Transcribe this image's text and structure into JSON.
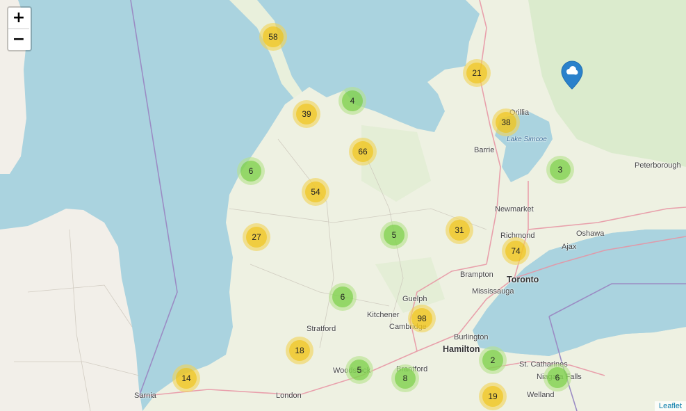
{
  "zoom_controls": {
    "zoom_in": "+",
    "zoom_out": "−"
  },
  "clusters": [
    {
      "count": "58",
      "size": "medium"
    },
    {
      "count": "21",
      "size": "medium"
    },
    {
      "count": "4",
      "size": "small"
    },
    {
      "count": "39",
      "size": "medium"
    },
    {
      "count": "38",
      "size": "medium"
    },
    {
      "count": "66",
      "size": "medium"
    },
    {
      "count": "6",
      "size": "small"
    },
    {
      "count": "3",
      "size": "small"
    },
    {
      "count": "54",
      "size": "medium"
    },
    {
      "count": "27",
      "size": "medium"
    },
    {
      "count": "5",
      "size": "small"
    },
    {
      "count": "31",
      "size": "medium"
    },
    {
      "count": "74",
      "size": "medium"
    },
    {
      "count": "6",
      "size": "small"
    },
    {
      "count": "98",
      "size": "medium"
    },
    {
      "count": "18",
      "size": "medium"
    },
    {
      "count": "5",
      "size": "small"
    },
    {
      "count": "8",
      "size": "small"
    },
    {
      "count": "2",
      "size": "small"
    },
    {
      "count": "6",
      "size": "small"
    },
    {
      "count": "14",
      "size": "medium"
    },
    {
      "count": "19",
      "size": "medium"
    }
  ],
  "places": {
    "orillia": "Orillia",
    "lake_simcoe": "Lake Simcoe",
    "barrie": "Barrie",
    "peterborough": "Peterborough",
    "newmarket": "Newmarket",
    "richmond": "Richmond",
    "oshawa": "Oshawa",
    "ajax": "Ajax",
    "brampton": "Brampton",
    "toronto": "Toronto",
    "mississauga": "Mississauga",
    "guelph": "Guelph",
    "kitchener": "Kitchener",
    "cambridge": "Cambridge",
    "stratford": "Stratford",
    "burlington": "Burlington",
    "hamilton": "Hamilton",
    "st_catharines": "St. Catharines",
    "niagara_falls": "Niagara Falls",
    "woodstock": "Woodstock",
    "brantford": "Brantford",
    "sarnia": "Sarnia",
    "london": "London",
    "welland": "Welland"
  },
  "marker": {
    "icon": "cloud-icon",
    "color": "#2A81CB"
  },
  "attribution": "Leaflet",
  "colors": {
    "water": "#aad3df",
    "land": "#f2efe9",
    "forest": "#d3e8c4",
    "border": "#9b8cc4"
  }
}
